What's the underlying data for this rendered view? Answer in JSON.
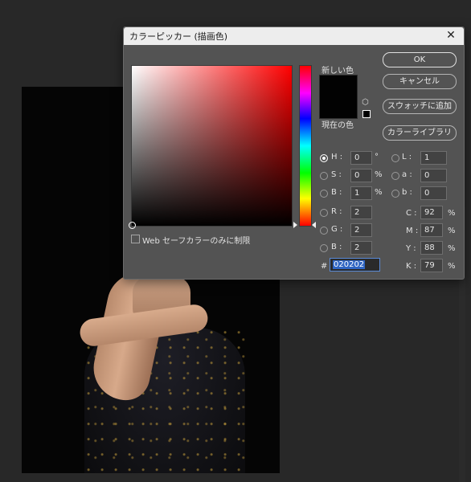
{
  "dialog": {
    "title": "カラーピッカー (描画色)",
    "new_label": "新しい色",
    "current_label": "現在の色",
    "new_color": "#020202",
    "current_color": "#020202",
    "hue_color": "#ff0000",
    "buttons": {
      "ok": "OK",
      "cancel": "キャンセル",
      "add_swatch": "スウォッチに追加",
      "libraries": "カラーライブラリ"
    },
    "web_safe_label": "Web セーフカラーのみに制限",
    "web_safe_checked": false,
    "selected_mode": "H",
    "hsb": [
      {
        "key": "H",
        "value": "0",
        "unit": "°"
      },
      {
        "key": "S",
        "value": "0",
        "unit": "%"
      },
      {
        "key": "B",
        "value": "1",
        "unit": "%"
      }
    ],
    "rgb": [
      {
        "key": "R",
        "value": "2"
      },
      {
        "key": "G",
        "value": "2"
      },
      {
        "key": "B",
        "value": "2"
      }
    ],
    "lab": [
      {
        "key": "L",
        "value": "1"
      },
      {
        "key": "a",
        "value": "0"
      },
      {
        "key": "b",
        "value": "0"
      }
    ],
    "cmyk": [
      {
        "key": "C",
        "value": "92",
        "unit": "%"
      },
      {
        "key": "M",
        "value": "87",
        "unit": "%"
      },
      {
        "key": "Y",
        "value": "88",
        "unit": "%"
      },
      {
        "key": "K",
        "value": "79",
        "unit": "%"
      }
    ],
    "hex_label": "#",
    "hex_value": "020202"
  }
}
